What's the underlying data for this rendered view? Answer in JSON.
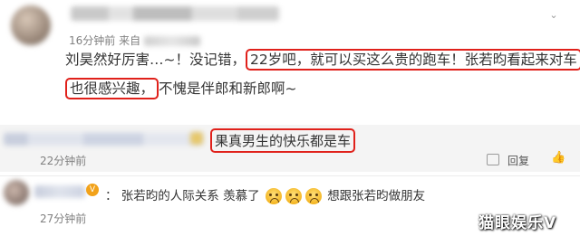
{
  "main_comment": {
    "timestamp": "16分钟前",
    "source_prefix": "来自",
    "line1_lead": "刘昊然好厉害…~！没记错，",
    "line1_highlight": "22岁吧，就可以买这么贵的跑车！张若昀看起来对车",
    "line2_highlight": "也很感兴趣，",
    "line2_tail": "不愧是伴郎和新郎啊~"
  },
  "reply": {
    "text": "果真男生的快乐都是车",
    "timestamp": "22分钟前",
    "reply_label": "回复"
  },
  "second_comment": {
    "part1": "：  张若昀的人际关系  羡慕了",
    "part2": "想跟张若昀做朋友",
    "timestamp": "27分钟前"
  },
  "watermark": "猫眼娱乐V",
  "colors": {
    "highlight_border": "#e0211b",
    "meta_gray": "#808080",
    "reply_bg": "#f4f4f4"
  },
  "icons": [
    "dropdown-arrow-icon",
    "reply-icon",
    "like-icon",
    "vip-badge-icon",
    "crying-emoji-icon"
  ]
}
